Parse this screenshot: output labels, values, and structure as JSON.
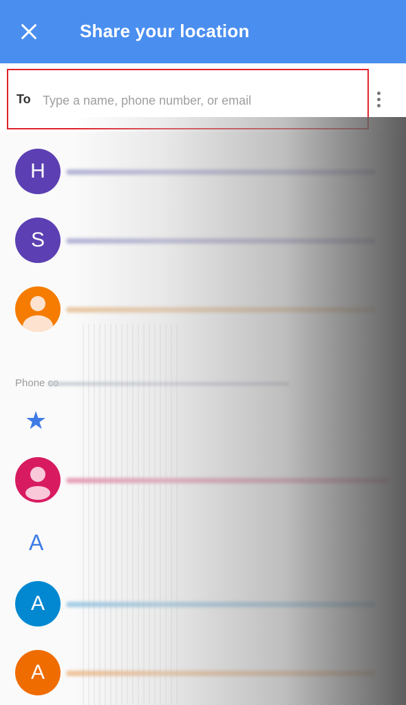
{
  "header": {
    "title": "Share your location",
    "close_icon": "close-icon",
    "color": "#4a8ef0"
  },
  "to_field": {
    "label": "To",
    "placeholder": "Type a name, phone number, or email",
    "value": "",
    "more_icon": "more-vert-icon"
  },
  "contacts": [
    {
      "initial": "H",
      "color": "#5b3fb3",
      "line_color": "#b8b7d8"
    },
    {
      "initial": "S",
      "color": "#5b3fb3",
      "line_color": "#b8b7d8"
    },
    {
      "initial": "",
      "icon": "person-icon",
      "color": "#f57c00",
      "line_color": "#eac9a5"
    }
  ],
  "phone_section": {
    "label": "Phone co",
    "starred_icon": "star-icon",
    "starred_contacts": [
      {
        "initial": "",
        "icon": "person-icon",
        "color": "#d81b60",
        "line_color": "#e8a3bb"
      }
    ],
    "letter_header": "A",
    "a_contacts": [
      {
        "initial": "A",
        "color": "#0288d1",
        "line_color": "#a6cde5"
      },
      {
        "initial": "A",
        "color": "#ef6c00",
        "line_color": "#efc49d"
      }
    ]
  }
}
